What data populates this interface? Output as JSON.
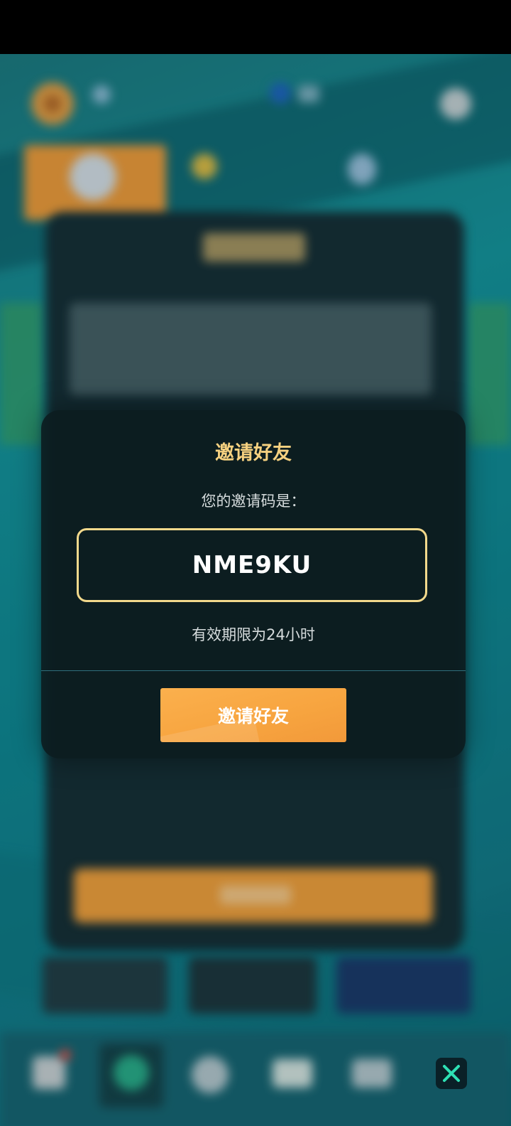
{
  "modal": {
    "title": "邀请好友",
    "subtitle": "您的邀请码是：",
    "invite_code": "NME9KU",
    "validity_text": "有效期限为24小时",
    "invite_button_label": "邀请好友"
  },
  "icons": {
    "close": "close-icon"
  },
  "colors": {
    "title": "#f6d180",
    "code_border": "#f3d98c",
    "button": "#f7a43f",
    "modal_bg": "#0c1c20",
    "close_x": "#2ee0b4"
  }
}
